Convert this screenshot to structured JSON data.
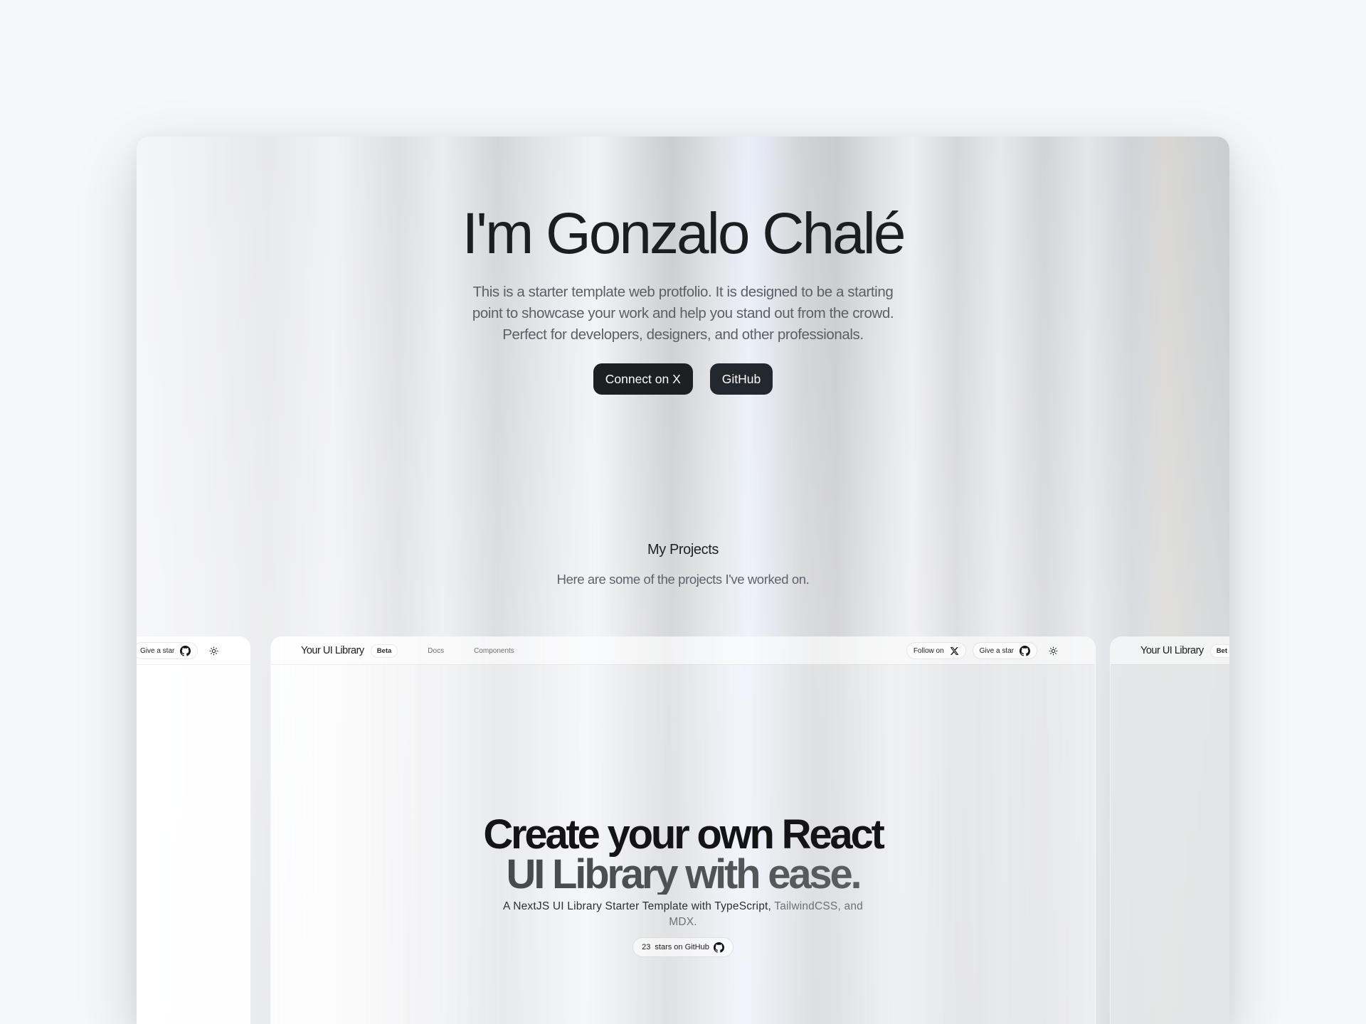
{
  "hero": {
    "title": "I'm Gonzalo Chalé",
    "description": "This is a starter template web protfolio. It is designed to be a starting point to showcase your work and help you stand out from the crowd. Perfect for developers, designers, and other professionals.",
    "connect_label": "Connect on X",
    "github_label": "GitHub"
  },
  "projects": {
    "title": "My Projects",
    "subtitle": "Here are some of the projects I've worked on."
  },
  "preview": {
    "brand": "Your UI Library",
    "badge": "Beta",
    "nav": [
      "Docs",
      "Components"
    ],
    "follow_label": "Follow on",
    "star_label": "Give a star",
    "headline_line1": "Create your own React",
    "headline_line2": "UI Library with ease.",
    "tagline_start": "A NextJS UI Library Starter Template with TypeScript,",
    "tagline_muted": "TailwindCSS,",
    "tagline_end": "and MDX.",
    "stars_count": "23",
    "stars_label": "stars on GitHub",
    "right_brand": "Your UI Library",
    "right_badge": "Bet"
  },
  "colors": {
    "background": "#f6f7f9",
    "button_dark": "#1e1f22",
    "text_primary": "#1c1d20",
    "text_muted": "#5b5f66"
  },
  "icons": [
    "github-icon",
    "x-logo-icon",
    "sun-icon"
  ]
}
